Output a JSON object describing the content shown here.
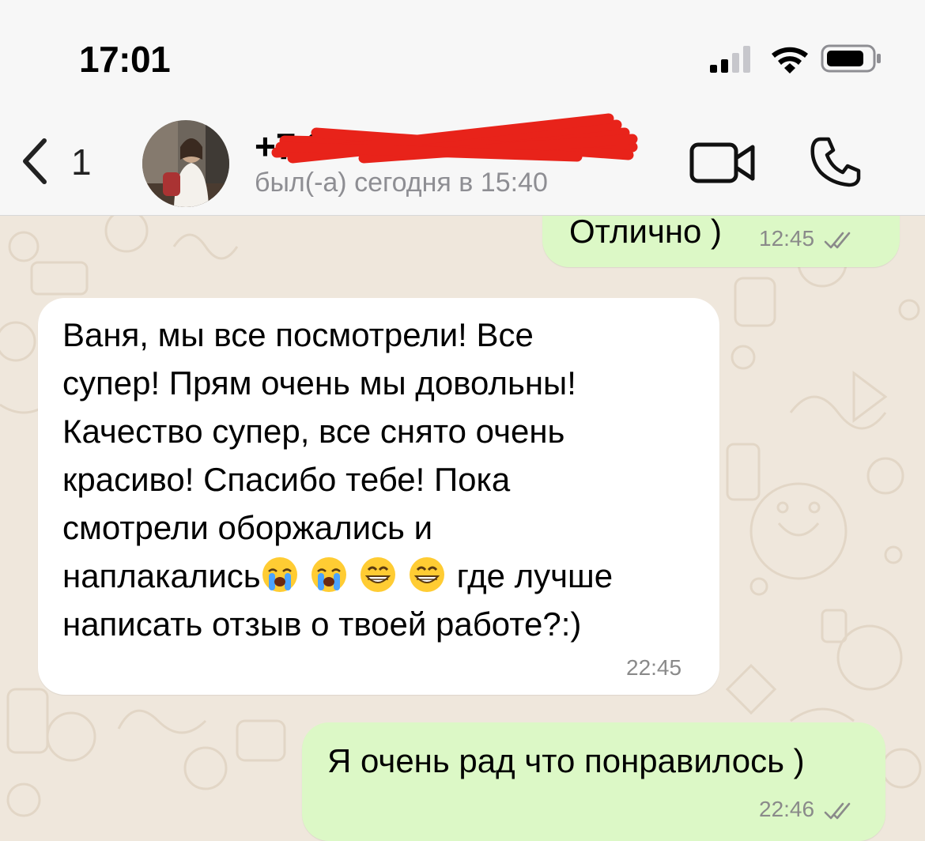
{
  "status_bar": {
    "time": "17:01"
  },
  "header": {
    "back_count": "1",
    "contact_name": "+7 9",
    "last_seen": "был(-а) сегодня в 15:40"
  },
  "messages": [
    {
      "direction": "out",
      "text": "Отлично )",
      "time": "12:45",
      "read": true
    },
    {
      "direction": "in",
      "lines": [
        "Ваня, мы все посмотрели! Все",
        "супер! Прям очень мы довольны!",
        "Качество супер, все снято очень",
        "красиво! Спасибо тебе! Пока",
        "смотрели оборжались и"
      ],
      "line6_prefix": "наплакались",
      "line6_suffix": "где лучше",
      "line7": "написать отзыв о твоей работе?:)",
      "emojis": [
        "loudly-crying-face",
        "loudly-crying-face",
        "grinning-face",
        "grinning-face"
      ],
      "time": "22:45"
    },
    {
      "direction": "out",
      "text": "Я очень рад что понравилось )",
      "time": "22:46",
      "read": true
    }
  ],
  "colors": {
    "outgoing_bubble": "#dcf8c6",
    "incoming_bubble": "#ffffff",
    "wallpaper": "#efe7dc",
    "header": "#f7f7f7",
    "redaction": "#e8231a"
  },
  "icons": [
    "signal-icon",
    "wifi-icon",
    "battery-icon",
    "back-chevron-icon",
    "video-call-icon",
    "phone-icon",
    "double-check-icon"
  ]
}
